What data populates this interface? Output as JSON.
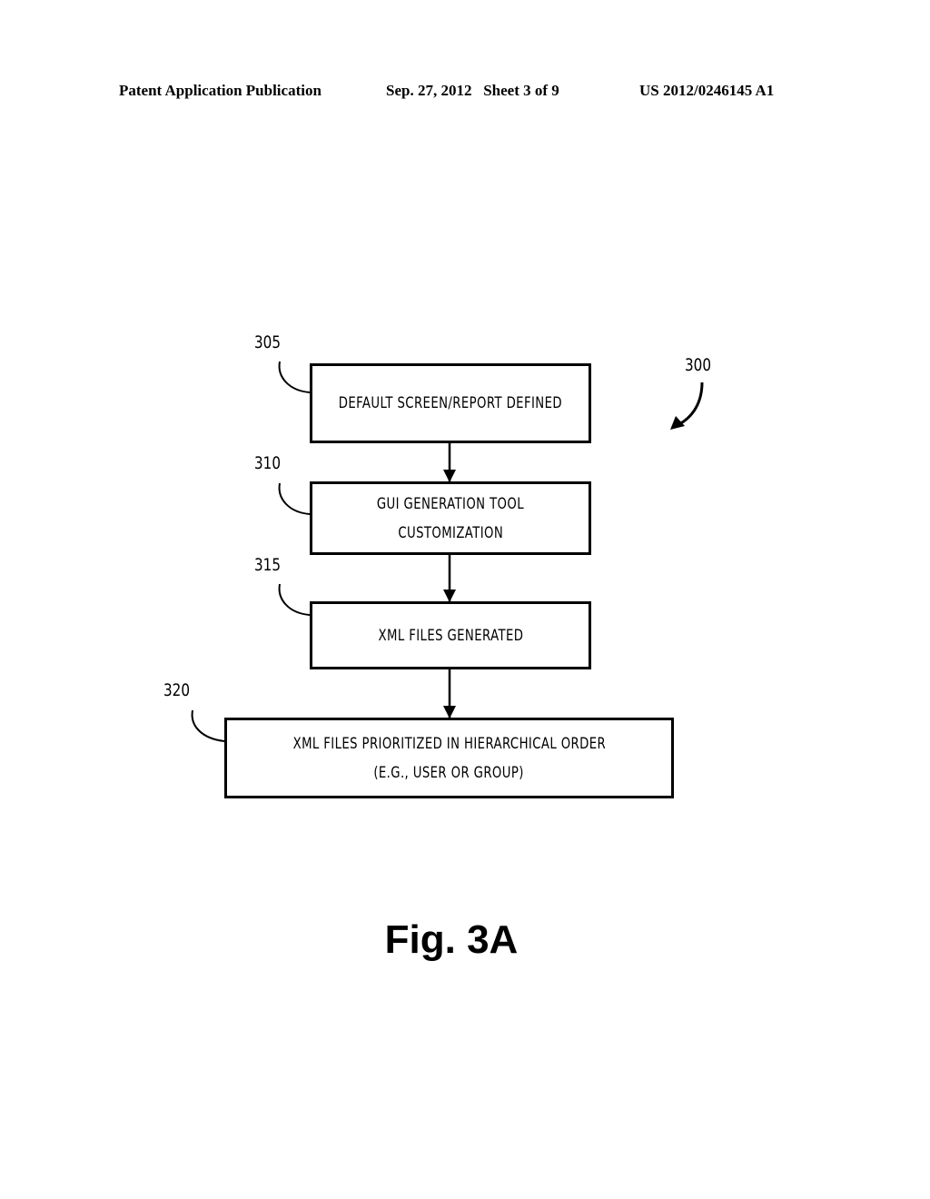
{
  "header": {
    "left": "Patent Application Publication",
    "date_sheet": "Sep. 27, 2012   Sheet 3 of 9",
    "pub_number": "US 2012/0246145 A1"
  },
  "diagram": {
    "figure_ref": "300",
    "steps": [
      {
        "ref": "305",
        "lines": [
          "DEFAULT SCREEN/REPORT DEFINED"
        ]
      },
      {
        "ref": "310",
        "lines": [
          "GUI GENERATION TOOL",
          "CUSTOMIZATION"
        ]
      },
      {
        "ref": "315",
        "lines": [
          "XML FILES GENERATED"
        ]
      },
      {
        "ref": "320",
        "lines": [
          "XML FILES PRIORITIZED IN HIERARCHICAL ORDER",
          "(E.G., USER OR GROUP)"
        ]
      }
    ],
    "caption": "Fig. 3A"
  }
}
